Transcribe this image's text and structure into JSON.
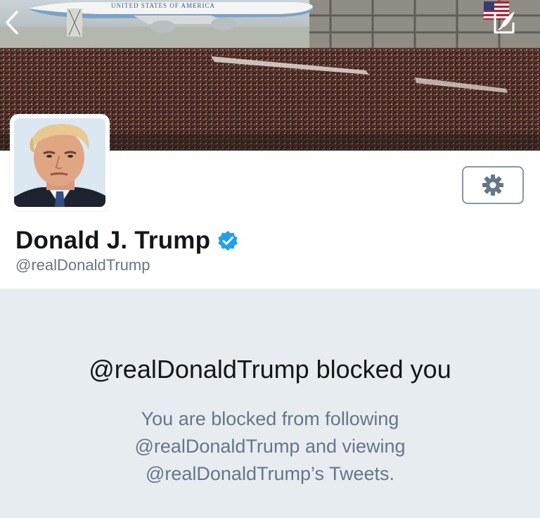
{
  "banner": {
    "plane_text": "UNITED STATES OF AMERICA"
  },
  "icons": {
    "back": "chevron-left-icon",
    "compose": "compose-tweet-icon",
    "settings": "gear-icon",
    "verified": "verified-badge-icon"
  },
  "profile": {
    "display_name": "Donald J. Trump",
    "handle": "@realDonaldTrump"
  },
  "blocked": {
    "title": "@realDonaldTrump blocked you",
    "desc_line1": "You are blocked from following",
    "desc_line2": "@realDonaldTrump and viewing",
    "desc_line3": "@realDonaldTrump’s Tweets."
  },
  "colors": {
    "verified": "#1da1f2",
    "blocked_bg": "#e6ecf0",
    "secondary_text": "#657786",
    "primary_text": "#14171a"
  }
}
